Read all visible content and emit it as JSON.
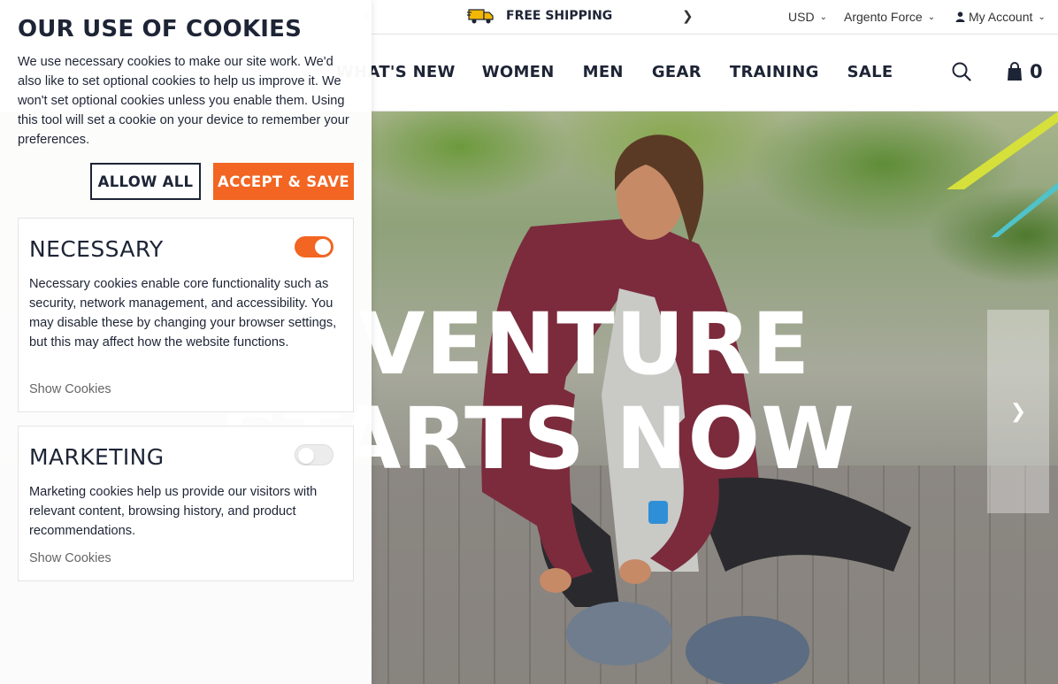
{
  "promo": {
    "prev": "‹",
    "text": "FREE SHIPPING",
    "next": "❯"
  },
  "utilities": {
    "currency": "USD",
    "store": "Argento Force",
    "account": "My Account"
  },
  "nav": {
    "items": [
      {
        "label": "WHAT'S NEW"
      },
      {
        "label": "WOMEN"
      },
      {
        "label": "MEN"
      },
      {
        "label": "GEAR"
      },
      {
        "label": "TRAINING"
      },
      {
        "label": "SALE"
      }
    ],
    "cart_count": "0"
  },
  "hero": {
    "line1": "ADVENTURE",
    "line2": "STARTS NOW",
    "next": "❯"
  },
  "cookies": {
    "title": "OUR USE OF COOKIES",
    "intro": "We use necessary cookies to make our site work. We'd also like to set optional cookies to help us improve it. We won't set optional cookies unless you enable them. Using this tool will set a cookie on your device to remember your preferences.",
    "allow_all": "ALLOW ALL",
    "accept_save": "ACCEPT & SAVE",
    "necessary": {
      "title": "NECESSARY",
      "enabled": true,
      "text": "Necessary cookies enable core functionality such as security, network management, and accessibility. You may disable these by changing your browser settings, but this may affect how the website functions.",
      "link": "Show Cookies"
    },
    "marketing": {
      "title": "MARKETING",
      "enabled": false,
      "text": "Marketing cookies help us provide our visitors with relevant content, browsing history, and product recommendations.",
      "link": "Show Cookies"
    }
  },
  "colors": {
    "accent": "#f26522",
    "text": "#1d2435"
  }
}
